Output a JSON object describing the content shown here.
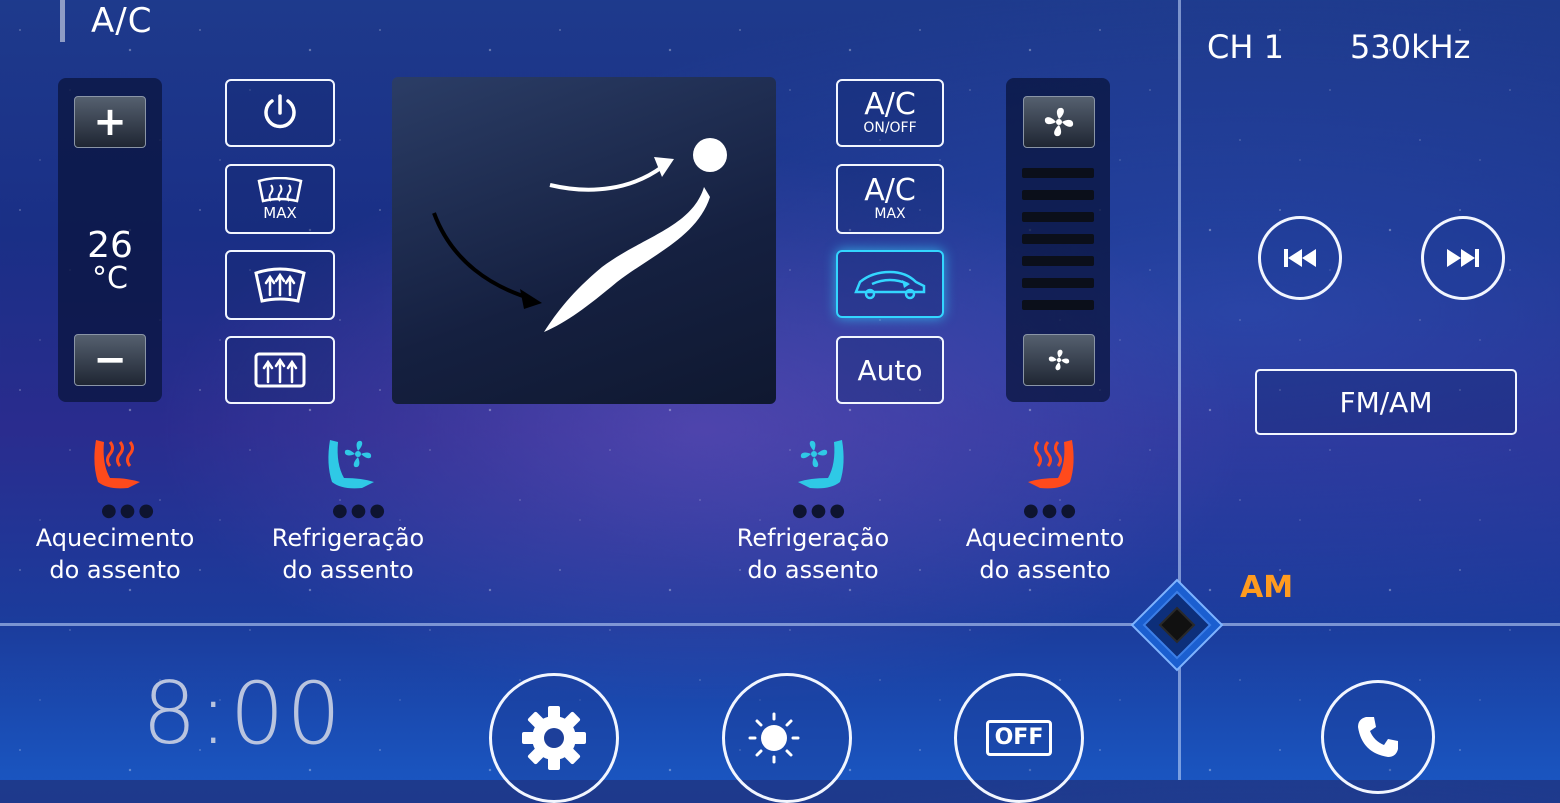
{
  "header": {
    "title": "A/C"
  },
  "temperature": {
    "plus_label": "+",
    "minus_label": "−",
    "value": "26",
    "unit": "°C"
  },
  "defrost_buttons": {
    "max_text": "MAX"
  },
  "ac_buttons": {
    "ac_onoff_main": "A/C",
    "ac_onoff_sub": "ON/OFF",
    "ac_max_main": "A/C",
    "ac_max_sub": "MAX",
    "auto_label": "Auto"
  },
  "seats": {
    "left_heat": {
      "line1": "Aquecimento",
      "line2": "do assento"
    },
    "left_cool": {
      "line1": "Refrigeração",
      "line2": "do assento"
    },
    "right_cool": {
      "line1": "Refrigeração",
      "line2": "do assento"
    },
    "right_heat": {
      "line1": "Aquecimento",
      "line2": "do assento"
    },
    "dots": "●●●"
  },
  "radio": {
    "channel": "CH 1",
    "frequency": "530kHz",
    "band_button": "FM/AM",
    "band": "AM"
  },
  "bottom": {
    "clock": "8:00",
    "off_label": "OFF"
  },
  "colors": {
    "heat": "#ff4a1c",
    "cool": "#2fc9e6",
    "accent": "#ff9b1f",
    "recirc_active": "#33d6ff"
  }
}
